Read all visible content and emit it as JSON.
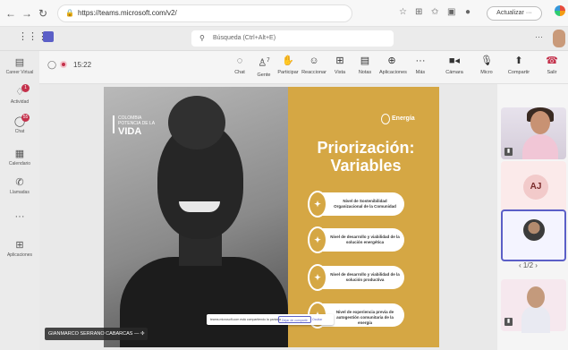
{
  "browser": {
    "url": "https://teams.microsoft.com/v2/",
    "update_label": "Actualizar",
    "icons": [
      "back-icon",
      "forward-icon",
      "reload-icon",
      "lock-icon",
      "star-icon",
      "extensions-icon",
      "favorites-icon",
      "profile-icon"
    ]
  },
  "teams_header": {
    "search_placeholder": "Búsqueda (Ctrl+Alt+E)",
    "more_label": "···"
  },
  "rail": {
    "items": [
      {
        "label": "Career Virtual",
        "icon": "book-icon"
      },
      {
        "label": "Actividad",
        "icon": "bell-icon",
        "badge": "1"
      },
      {
        "label": "Chat",
        "icon": "chat-icon",
        "badge": "55"
      },
      {
        "label": "Calendario",
        "icon": "calendar-icon"
      },
      {
        "label": "Llamadas",
        "icon": "phone-icon"
      },
      {
        "label": "···",
        "icon": "more-icon"
      },
      {
        "label": "Aplicaciones",
        "icon": "apps-icon"
      }
    ]
  },
  "meeting": {
    "timer": "15:22",
    "toolbar": [
      {
        "label": "Chat",
        "icon": "chat-icon"
      },
      {
        "label": "Gente",
        "icon": "people-icon",
        "count": "7"
      },
      {
        "label": "Participar",
        "icon": "hand-icon"
      },
      {
        "label": "Reaccionar",
        "icon": "emoji-icon"
      },
      {
        "label": "Vista",
        "icon": "grid-icon"
      },
      {
        "label": "Notas",
        "icon": "notes-icon"
      },
      {
        "label": "Aplicaciones",
        "icon": "plus-icon"
      },
      {
        "label": "Más",
        "icon": "more-icon"
      },
      {
        "label": "Cámara",
        "icon": "camera-icon"
      },
      {
        "label": "Micro",
        "icon": "mic-off-icon"
      },
      {
        "label": "Compartir",
        "icon": "share-icon"
      },
      {
        "label": "Salir",
        "icon": "hangup-icon"
      }
    ],
    "presenter_name": "GIANMARCO SERRANO CABARCAS",
    "pager": "1/2"
  },
  "slide": {
    "brand_small": "COLOMBIA POTENCIA DE LA",
    "brand_big": "VIDA",
    "topic": "Energía",
    "title_line1": "Priorización:",
    "title_line2": "Variables",
    "items": [
      "Nivel de Sostenibilidad Organizacional de la Comunidad",
      "Nivel de desarrollo y viabilidad de la solución energética",
      "Nivel de desarrollo y viabilidad de la solución productiva",
      "Nivel de experiencia previa de autogestión comunitaria de la energía"
    ],
    "share_notice": "teams.microsoft.com está compartiendo la pantalla",
    "stop_label": "Dejar de compartir",
    "hide_label": "Ocultar"
  },
  "participants": {
    "aj_initials": "AJ"
  }
}
